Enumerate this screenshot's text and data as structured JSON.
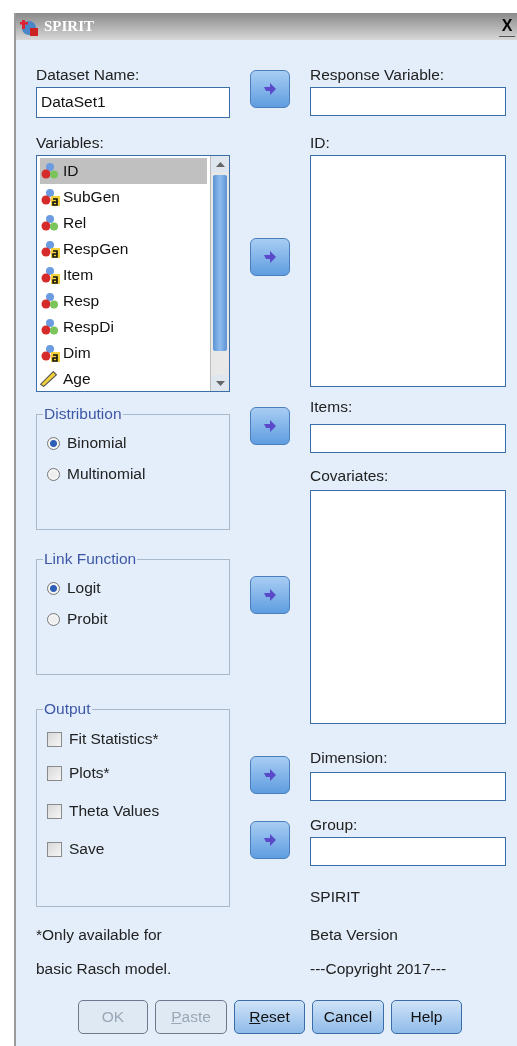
{
  "window": {
    "title": "SPIRIT",
    "close": "X"
  },
  "dataset": {
    "label": "Dataset Name:",
    "value": "DataSet1"
  },
  "variables": {
    "label": "Variables:",
    "items": [
      {
        "name": "ID",
        "kind": "nominal",
        "selected": true
      },
      {
        "name": "SubGen",
        "kind": "string",
        "selected": false
      },
      {
        "name": "Rel",
        "kind": "nominal",
        "selected": false
      },
      {
        "name": "RespGen",
        "kind": "string",
        "selected": false
      },
      {
        "name": "Item",
        "kind": "string",
        "selected": false
      },
      {
        "name": "Resp",
        "kind": "nominal",
        "selected": false
      },
      {
        "name": "RespDi",
        "kind": "nominal",
        "selected": false
      },
      {
        "name": "Dim",
        "kind": "string",
        "selected": false
      },
      {
        "name": "Age",
        "kind": "scale",
        "selected": false
      }
    ]
  },
  "distribution": {
    "legend": "Distribution",
    "options": [
      {
        "label": "Binomial",
        "selected": true
      },
      {
        "label": "Multinomial",
        "selected": false
      }
    ]
  },
  "link_function": {
    "legend": "Link Function",
    "options": [
      {
        "label": "Logit",
        "selected": true
      },
      {
        "label": "Probit",
        "selected": false
      }
    ]
  },
  "output": {
    "legend": "Output",
    "options": [
      {
        "label": "Fit Statistics*",
        "checked": false
      },
      {
        "label": "Plots*",
        "checked": false
      },
      {
        "label": "Theta Values",
        "checked": false
      },
      {
        "label": "Save",
        "checked": false
      }
    ]
  },
  "footnote": [
    "*Only available for",
    "basic Rasch model."
  ],
  "targets": [
    {
      "label": "Response Variable:",
      "kind": "field"
    },
    {
      "label": "ID:",
      "kind": "list"
    },
    {
      "label": "Items:",
      "kind": "field"
    },
    {
      "label": "Covariates:",
      "kind": "list"
    },
    {
      "label": "Dimension:",
      "kind": "field"
    },
    {
      "label": "Group:",
      "kind": "field"
    }
  ],
  "about": [
    "SPIRIT",
    "Beta Version",
    "---Copyright 2017---"
  ],
  "buttons": [
    {
      "label": "OK",
      "disabled": true,
      "underline_first": false
    },
    {
      "label": "Paste",
      "disabled": true,
      "underline_first": true
    },
    {
      "label": "Reset",
      "disabled": false,
      "underline_first": true
    },
    {
      "label": "Cancel",
      "disabled": false,
      "underline_first": false
    },
    {
      "label": "Help",
      "disabled": false,
      "underline_first": false
    }
  ]
}
